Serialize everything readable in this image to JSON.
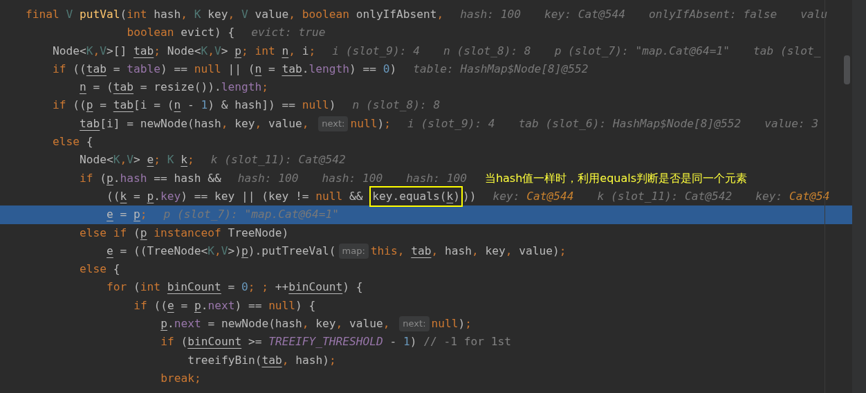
{
  "editor": {
    "lines": [
      {
        "kind": "statement",
        "current": false,
        "tokens": [
          {
            "kind": "kw",
            "text": "final "
          },
          {
            "kind": "tp",
            "text": "V "
          },
          {
            "kind": "fn",
            "text": "putVal"
          },
          {
            "kind": "p",
            "text": "("
          },
          {
            "kind": "kw",
            "text": "int "
          },
          {
            "kind": "p",
            "text": "hash"
          },
          {
            "kind": "kw",
            "text": ", "
          },
          {
            "kind": "tp",
            "text": "K "
          },
          {
            "kind": "p",
            "text": "key"
          },
          {
            "kind": "kw",
            "text": ", "
          },
          {
            "kind": "tp",
            "text": "V "
          },
          {
            "kind": "p",
            "text": "value"
          },
          {
            "kind": "kw",
            "text": ", "
          },
          {
            "kind": "kw",
            "text": "boolean "
          },
          {
            "kind": "p",
            "text": "onlyIfAbsent"
          },
          {
            "kind": "kw",
            "text": ","
          },
          {
            "kind": "h",
            "text": "hash: 100"
          },
          {
            "kind": "h",
            "text": "key: Cat@544"
          },
          {
            "kind": "h",
            "text": "onlyIfAbsent: false"
          },
          {
            "kind": "h",
            "text": "valu"
          }
        ],
        "children": [
          {
            "kind": "continuation",
            "current": false,
            "tokens": [
              {
                "kind": "kw",
                "text": "boolean "
              },
              {
                "kind": "p",
                "text": "evict) {"
              },
              {
                "kind": "h",
                "text": "evict: true"
              }
            ]
          },
          {
            "kind": "statement",
            "current": false,
            "tokens": [
              {
                "kind": "p",
                "text": "Node<"
              },
              {
                "kind": "tp",
                "text": "K"
              },
              {
                "kind": "kw",
                "text": ","
              },
              {
                "kind": "tp",
                "text": "V"
              },
              {
                "kind": "p",
                "text": ">[] "
              },
              {
                "kind": "v",
                "text": "tab"
              },
              {
                "kind": "kw",
                "text": "; "
              },
              {
                "kind": "p",
                "text": "Node<"
              },
              {
                "kind": "tp",
                "text": "K"
              },
              {
                "kind": "kw",
                "text": ","
              },
              {
                "kind": "tp",
                "text": "V"
              },
              {
                "kind": "p",
                "text": "> "
              },
              {
                "kind": "v",
                "text": "p"
              },
              {
                "kind": "kw",
                "text": "; "
              },
              {
                "kind": "kw",
                "text": "int "
              },
              {
                "kind": "v",
                "text": "n"
              },
              {
                "kind": "kw",
                "text": ", "
              },
              {
                "kind": "p",
                "text": "i"
              },
              {
                "kind": "kw",
                "text": ";"
              },
              {
                "kind": "h",
                "text": "i (slot_9): 4"
              },
              {
                "kind": "h",
                "text": "n (slot_8): 8"
              },
              {
                "kind": "h",
                "text": "p (slot_7): \"map.Cat@64=1\""
              },
              {
                "kind": "h",
                "text": "tab (slot_"
              }
            ]
          },
          {
            "kind": "statement",
            "current": false,
            "tokens": [
              {
                "kind": "kw",
                "text": "if "
              },
              {
                "kind": "p",
                "text": "(("
              },
              {
                "kind": "v",
                "text": "tab"
              },
              {
                "kind": "p",
                "text": " = "
              },
              {
                "kind": "f",
                "text": "table"
              },
              {
                "kind": "p",
                "text": ") == "
              },
              {
                "kind": "kw",
                "text": "null"
              },
              {
                "kind": "p",
                "text": " || ("
              },
              {
                "kind": "v",
                "text": "n"
              },
              {
                "kind": "p",
                "text": " = "
              },
              {
                "kind": "v",
                "text": "tab"
              },
              {
                "kind": "p",
                "text": "."
              },
              {
                "kind": "f",
                "text": "length"
              },
              {
                "kind": "p",
                "text": ") == "
              },
              {
                "kind": "n",
                "text": "0"
              },
              {
                "kind": "p",
                "text": ")"
              },
              {
                "kind": "h",
                "text": "table: HashMap$Node[8]@552"
              }
            ],
            "children": [
              {
                "kind": "statement",
                "current": false,
                "tokens": [
                  {
                    "kind": "v",
                    "text": "n"
                  },
                  {
                    "kind": "p",
                    "text": " = ("
                  },
                  {
                    "kind": "v",
                    "text": "tab"
                  },
                  {
                    "kind": "p",
                    "text": " = resize())."
                  },
                  {
                    "kind": "f",
                    "text": "length"
                  },
                  {
                    "kind": "kw",
                    "text": ";"
                  }
                ]
              }
            ]
          },
          {
            "kind": "statement",
            "current": false,
            "tokens": [
              {
                "kind": "kw",
                "text": "if "
              },
              {
                "kind": "p",
                "text": "(("
              },
              {
                "kind": "v",
                "text": "p"
              },
              {
                "kind": "p",
                "text": " = "
              },
              {
                "kind": "v",
                "text": "tab"
              },
              {
                "kind": "p",
                "text": "[i = ("
              },
              {
                "kind": "v",
                "text": "n"
              },
              {
                "kind": "p",
                "text": " - "
              },
              {
                "kind": "n",
                "text": "1"
              },
              {
                "kind": "p",
                "text": ") & hash]) == "
              },
              {
                "kind": "kw",
                "text": "null"
              },
              {
                "kind": "p",
                "text": ")"
              },
              {
                "kind": "h",
                "text": "n (slot_8): 8"
              }
            ],
            "children": [
              {
                "kind": "statement",
                "current": false,
                "tokens": [
                  {
                    "kind": "v",
                    "text": "tab"
                  },
                  {
                    "kind": "p",
                    "text": "[i] = newNode(hash"
                  },
                  {
                    "kind": "kw",
                    "text": ", "
                  },
                  {
                    "kind": "p",
                    "text": "key"
                  },
                  {
                    "kind": "kw",
                    "text": ", "
                  },
                  {
                    "kind": "p",
                    "text": "value"
                  },
                  {
                    "kind": "kw",
                    "text": ", "
                  },
                  {
                    "kind": "inlay",
                    "text": "next:"
                  },
                  {
                    "kind": "kw",
                    "text": "null"
                  },
                  {
                    "kind": "p",
                    "text": ")"
                  },
                  {
                    "kind": "kw",
                    "text": ";"
                  },
                  {
                    "kind": "h",
                    "text": "i (slot_9): 4"
                  },
                  {
                    "kind": "h",
                    "text": "tab (slot_6): HashMap$Node[8]@552"
                  },
                  {
                    "kind": "h",
                    "text": "value: 3"
                  }
                ]
              }
            ]
          },
          {
            "kind": "statement",
            "current": false,
            "tokens": [
              {
                "kind": "kw",
                "text": "else "
              },
              {
                "kind": "p",
                "text": "{"
              }
            ],
            "children": [
              {
                "kind": "statement",
                "current": false,
                "tokens": [
                  {
                    "kind": "p",
                    "text": "Node<"
                  },
                  {
                    "kind": "tp",
                    "text": "K"
                  },
                  {
                    "kind": "kw",
                    "text": ","
                  },
                  {
                    "kind": "tp",
                    "text": "V"
                  },
                  {
                    "kind": "p",
                    "text": "> "
                  },
                  {
                    "kind": "v",
                    "text": "e"
                  },
                  {
                    "kind": "kw",
                    "text": "; "
                  },
                  {
                    "kind": "tp",
                    "text": "K "
                  },
                  {
                    "kind": "v",
                    "text": "k"
                  },
                  {
                    "kind": "kw",
                    "text": ";"
                  },
                  {
                    "kind": "h",
                    "text": "k (slot_11): Cat@542"
                  }
                ]
              },
              {
                "kind": "statement",
                "current": false,
                "tokens": [
                  {
                    "kind": "kw",
                    "text": "if "
                  },
                  {
                    "kind": "p",
                    "text": "("
                  },
                  {
                    "kind": "v",
                    "text": "p"
                  },
                  {
                    "kind": "p",
                    "text": "."
                  },
                  {
                    "kind": "f",
                    "text": "hash"
                  },
                  {
                    "kind": "p",
                    "text": " == hash &&"
                  },
                  {
                    "kind": "h",
                    "text": "hash: 100"
                  },
                  {
                    "kind": "h",
                    "text": "hash: 100"
                  },
                  {
                    "kind": "h",
                    "text": "hash: 100"
                  },
                  {
                    "kind": "note",
                    "text": "当hash值一样时，利用equals判断是否是同一个元素"
                  }
                ],
                "children": [
                  {
                    "kind": "statement",
                    "current": false,
                    "tokens": [
                      {
                        "kind": "p",
                        "text": "(("
                      },
                      {
                        "kind": "v",
                        "text": "k"
                      },
                      {
                        "kind": "p",
                        "text": " = "
                      },
                      {
                        "kind": "v",
                        "text": "p"
                      },
                      {
                        "kind": "p",
                        "text": "."
                      },
                      {
                        "kind": "f",
                        "text": "key"
                      },
                      {
                        "kind": "p",
                        "text": ") == key || (key != "
                      },
                      {
                        "kind": "kw",
                        "text": "null"
                      },
                      {
                        "kind": "p",
                        "text": " && "
                      },
                      {
                        "kind": "box",
                        "children": [
                          {
                            "kind": "p",
                            "text": "key.equals("
                          },
                          {
                            "kind": "v",
                            "text": "k"
                          },
                          {
                            "kind": "p",
                            "text": ")"
                          }
                        ]
                      },
                      {
                        "kind": "p",
                        "text": "))"
                      },
                      {
                        "kind": "h",
                        "text": "key: "
                      },
                      {
                        "kind": "hv",
                        "text": "Cat@544"
                      },
                      {
                        "kind": "h",
                        "text": "k (slot_11): Cat@542"
                      },
                      {
                        "kind": "h",
                        "text": "key: "
                      },
                      {
                        "kind": "hv",
                        "text": "Cat@54"
                      }
                    ]
                  },
                  {
                    "kind": "statement",
                    "current": true,
                    "tokens": [
                      {
                        "kind": "v",
                        "text": "e"
                      },
                      {
                        "kind": "p",
                        "text": " = "
                      },
                      {
                        "kind": "v",
                        "text": "p"
                      },
                      {
                        "kind": "kw",
                        "text": ";"
                      },
                      {
                        "kind": "h",
                        "text": "p (slot_7): \"map.Cat@64=1\""
                      }
                    ]
                  }
                ]
              },
              {
                "kind": "statement",
                "current": false,
                "tokens": [
                  {
                    "kind": "kw",
                    "text": "else if "
                  },
                  {
                    "kind": "p",
                    "text": "("
                  },
                  {
                    "kind": "v",
                    "text": "p"
                  },
                  {
                    "kind": "kw",
                    "text": " instanceof "
                  },
                  {
                    "kind": "p",
                    "text": "TreeNode)"
                  }
                ],
                "children": [
                  {
                    "kind": "statement",
                    "current": false,
                    "tokens": [
                      {
                        "kind": "v",
                        "text": "e"
                      },
                      {
                        "kind": "p",
                        "text": " = ((TreeNode<"
                      },
                      {
                        "kind": "tp",
                        "text": "K"
                      },
                      {
                        "kind": "kw",
                        "text": ","
                      },
                      {
                        "kind": "tp",
                        "text": "V"
                      },
                      {
                        "kind": "p",
                        "text": ">)"
                      },
                      {
                        "kind": "v",
                        "text": "p"
                      },
                      {
                        "kind": "p",
                        "text": ").putTreeVal("
                      },
                      {
                        "kind": "inlay",
                        "text": "map:"
                      },
                      {
                        "kind": "kw",
                        "text": "this"
                      },
                      {
                        "kind": "kw",
                        "text": ", "
                      },
                      {
                        "kind": "v",
                        "text": "tab"
                      },
                      {
                        "kind": "kw",
                        "text": ", "
                      },
                      {
                        "kind": "p",
                        "text": "hash"
                      },
                      {
                        "kind": "kw",
                        "text": ", "
                      },
                      {
                        "kind": "p",
                        "text": "key"
                      },
                      {
                        "kind": "kw",
                        "text": ", "
                      },
                      {
                        "kind": "p",
                        "text": "value)"
                      },
                      {
                        "kind": "kw",
                        "text": ";"
                      }
                    ]
                  }
                ]
              },
              {
                "kind": "statement",
                "current": false,
                "tokens": [
                  {
                    "kind": "kw",
                    "text": "else "
                  },
                  {
                    "kind": "p",
                    "text": "{"
                  }
                ],
                "children": [
                  {
                    "kind": "statement",
                    "current": false,
                    "tokens": [
                      {
                        "kind": "kw",
                        "text": "for "
                      },
                      {
                        "kind": "p",
                        "text": "("
                      },
                      {
                        "kind": "kw",
                        "text": "int "
                      },
                      {
                        "kind": "v",
                        "text": "binCount"
                      },
                      {
                        "kind": "p",
                        "text": " = "
                      },
                      {
                        "kind": "n",
                        "text": "0"
                      },
                      {
                        "kind": "kw",
                        "text": "; ; "
                      },
                      {
                        "kind": "p",
                        "text": "++"
                      },
                      {
                        "kind": "v",
                        "text": "binCount"
                      },
                      {
                        "kind": "p",
                        "text": ") {"
                      }
                    ],
                    "children": [
                      {
                        "kind": "statement",
                        "current": false,
                        "tokens": [
                          {
                            "kind": "kw",
                            "text": "if "
                          },
                          {
                            "kind": "p",
                            "text": "(("
                          },
                          {
                            "kind": "v",
                            "text": "e"
                          },
                          {
                            "kind": "p",
                            "text": " = "
                          },
                          {
                            "kind": "v",
                            "text": "p"
                          },
                          {
                            "kind": "p",
                            "text": "."
                          },
                          {
                            "kind": "f",
                            "text": "next"
                          },
                          {
                            "kind": "p",
                            "text": ") == "
                          },
                          {
                            "kind": "kw",
                            "text": "null"
                          },
                          {
                            "kind": "p",
                            "text": ") {"
                          }
                        ],
                        "children": [
                          {
                            "kind": "statement",
                            "current": false,
                            "tokens": [
                              {
                                "kind": "v",
                                "text": "p"
                              },
                              {
                                "kind": "p",
                                "text": "."
                              },
                              {
                                "kind": "f",
                                "text": "next"
                              },
                              {
                                "kind": "p",
                                "text": " = newNode(hash"
                              },
                              {
                                "kind": "kw",
                                "text": ", "
                              },
                              {
                                "kind": "p",
                                "text": "key"
                              },
                              {
                                "kind": "kw",
                                "text": ", "
                              },
                              {
                                "kind": "p",
                                "text": "value"
                              },
                              {
                                "kind": "kw",
                                "text": ", "
                              },
                              {
                                "kind": "inlay",
                                "text": "next:"
                              },
                              {
                                "kind": "kw",
                                "text": "null"
                              },
                              {
                                "kind": "p",
                                "text": ")"
                              },
                              {
                                "kind": "kw",
                                "text": ";"
                              }
                            ]
                          },
                          {
                            "kind": "statement",
                            "current": false,
                            "tokens": [
                              {
                                "kind": "kw",
                                "text": "if "
                              },
                              {
                                "kind": "p",
                                "text": "("
                              },
                              {
                                "kind": "v",
                                "text": "binCount"
                              },
                              {
                                "kind": "p",
                                "text": " >= "
                              },
                              {
                                "kind": "k",
                                "text": "TREEIFY_THRESHOLD"
                              },
                              {
                                "kind": "p",
                                "text": " - "
                              },
                              {
                                "kind": "n",
                                "text": "1"
                              },
                              {
                                "kind": "p",
                                "text": ") "
                              },
                              {
                                "kind": "c",
                                "text": "// -1 for 1st"
                              }
                            ],
                            "children": [
                              {
                                "kind": "statement",
                                "current": false,
                                "tokens": [
                                  {
                                    "kind": "p",
                                    "text": "treeifyBin("
                                  },
                                  {
                                    "kind": "v",
                                    "text": "tab"
                                  },
                                  {
                                    "kind": "kw",
                                    "text": ", "
                                  },
                                  {
                                    "kind": "p",
                                    "text": "hash)"
                                  },
                                  {
                                    "kind": "kw",
                                    "text": ";"
                                  }
                                ]
                              }
                            ]
                          },
                          {
                            "kind": "statement",
                            "current": false,
                            "tokens": [
                              {
                                "kind": "kw",
                                "text": "break;"
                              }
                            ]
                          }
                        ]
                      }
                    ]
                  }
                ]
              }
            ]
          }
        ]
      }
    ]
  }
}
